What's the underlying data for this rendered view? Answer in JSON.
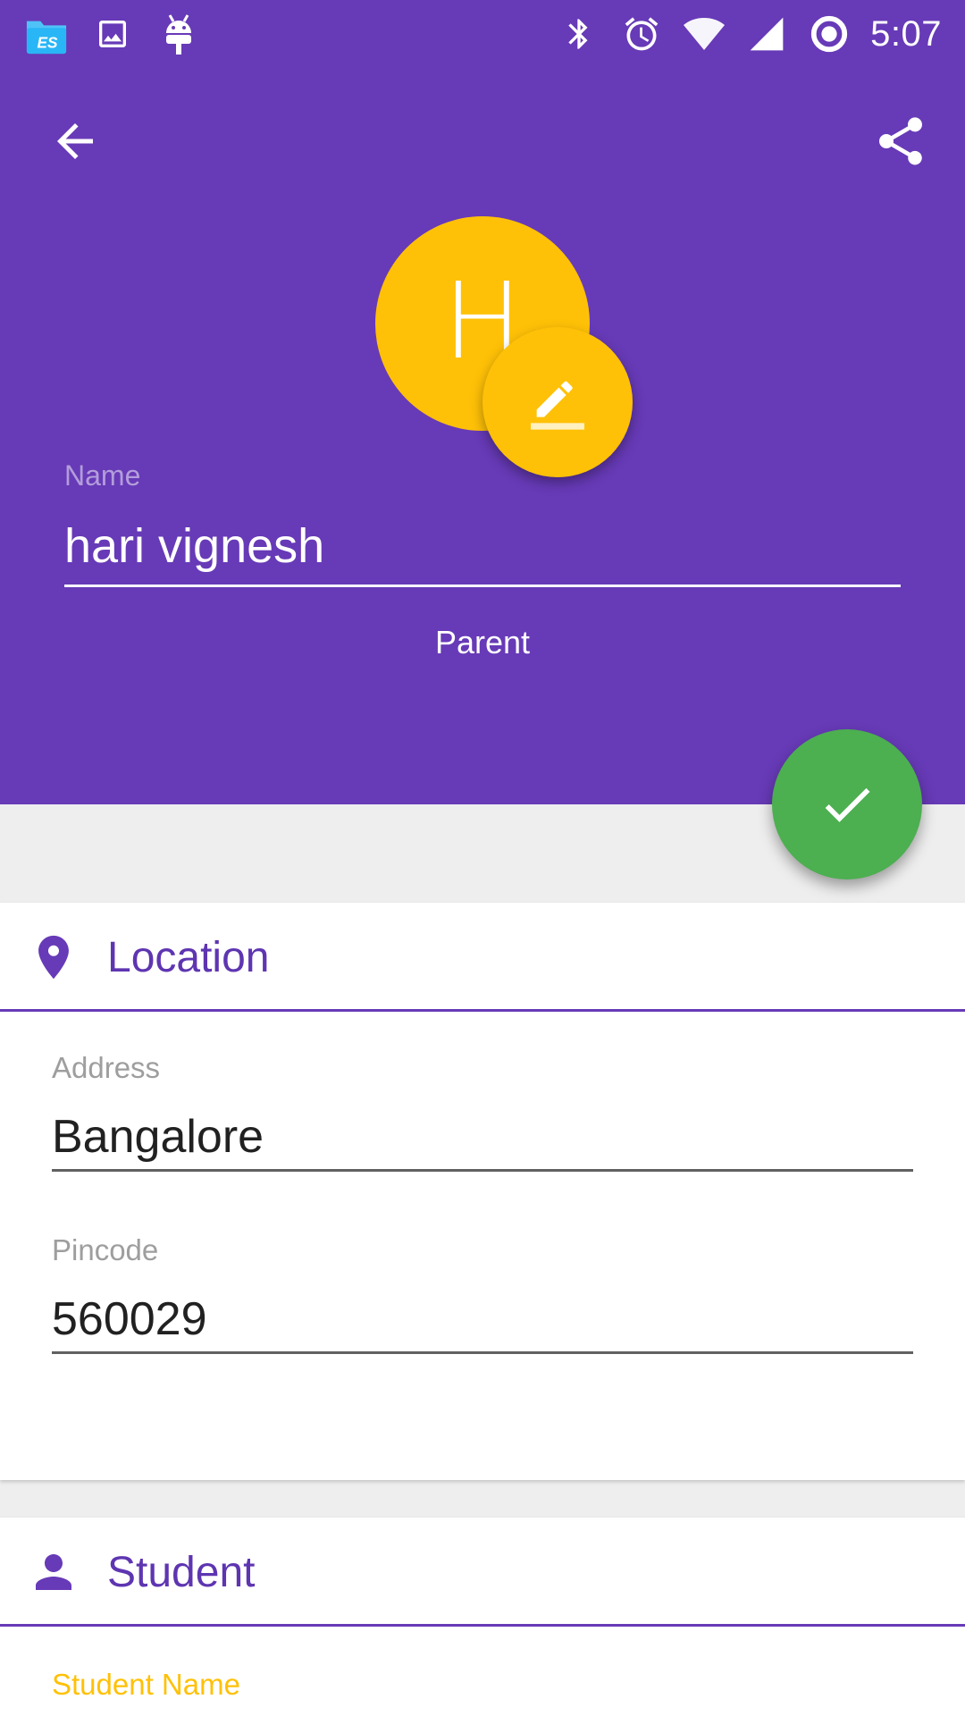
{
  "status_bar": {
    "time": "5:07",
    "left_icons": [
      "file-manager-icon",
      "image-icon",
      "android-debug-icon"
    ],
    "right_icons": [
      "bluetooth-icon",
      "alarm-icon",
      "wifi-icon",
      "cell-signal-icon",
      "sync-icon"
    ]
  },
  "toolbar": {
    "back_icon": "arrow-back-icon",
    "share_icon": "share-icon"
  },
  "profile": {
    "avatar_letter": "H",
    "name_label": "Name",
    "name_value": "hari vignesh",
    "role": "Parent"
  },
  "location_section": {
    "title": "Location",
    "icon": "location-pin-icon",
    "address": {
      "label": "Address",
      "value": "Bangalore"
    },
    "pincode": {
      "label": "Pincode",
      "value": "560029"
    }
  },
  "student_section": {
    "title": "Student",
    "icon": "person-icon",
    "student_name": {
      "label": "Student Name"
    }
  },
  "colors": {
    "primary": "#673ab7",
    "avatar": "#ffc107",
    "save_fab": "#4caf50",
    "section_title": "#5e35b1",
    "focused_label": "#ffc107"
  }
}
